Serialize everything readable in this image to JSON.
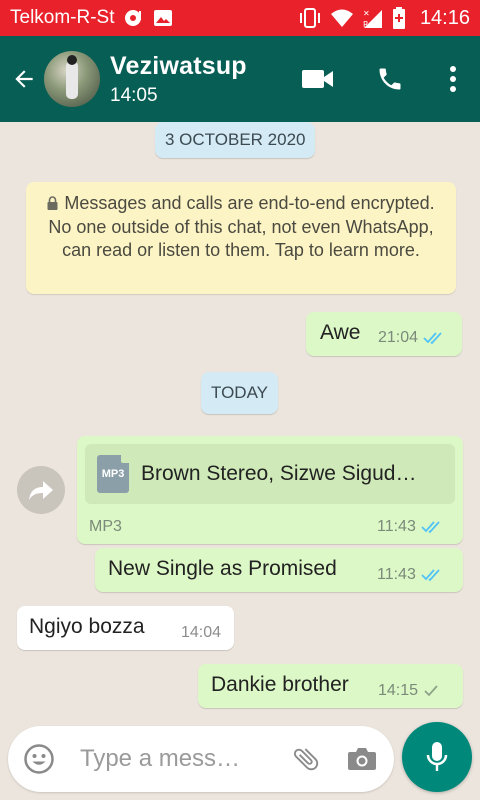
{
  "status_bar": {
    "carrier": "Telkom-R-St",
    "time": "14:16"
  },
  "header": {
    "contact_name": "Veziwatsup",
    "subtitle": "14:05",
    "icons": [
      "back-arrow-icon",
      "video-call-icon",
      "voice-call-icon",
      "more-options-icon"
    ]
  },
  "chat": {
    "date_chip_1": "3 OCTOBER 2020",
    "encryption_notice": "Messages and calls are end-to-end encrypted. No one outside of this chat, not even WhatsApp, can read or listen to them. Tap to learn more.",
    "date_chip_2": "TODAY",
    "messages": [
      {
        "direction": "out",
        "text": "Awe",
        "time": "21:04",
        "status": "read"
      },
      {
        "direction": "out",
        "type": "file",
        "file_icon_label": "MP3",
        "file_name": "Brown Stereo, Sizwe Sigud…",
        "file_type": "MP3",
        "time": "11:43",
        "status": "read"
      },
      {
        "direction": "out",
        "text": "New Single as Promised",
        "time": "11:43",
        "status": "read"
      },
      {
        "direction": "in",
        "text": "Ngiyo bozza",
        "time": "14:04"
      },
      {
        "direction": "out",
        "text": "Dankie brother",
        "time": "14:15",
        "status": "sent"
      }
    ]
  },
  "composer": {
    "placeholder": "Type a mess…"
  },
  "colors": {
    "status_bar": "#e8212b",
    "app_bar": "#075e54",
    "outgoing_bubble": "#dcf8c6",
    "incoming_bubble": "#ffffff",
    "read_tick": "#4fc3f7",
    "mic_button": "#00897b"
  }
}
